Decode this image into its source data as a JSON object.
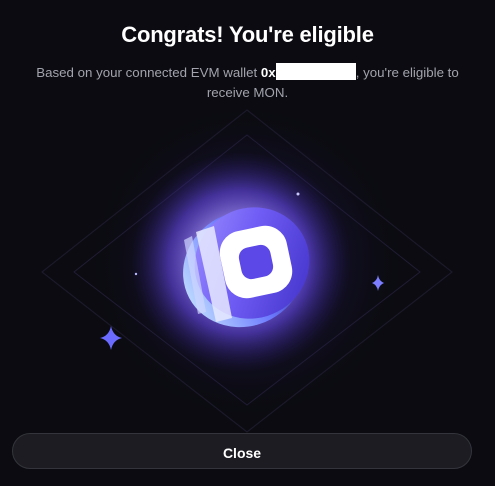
{
  "modal": {
    "title": "Congrats! You're eligible",
    "description_before": "Based on your connected EVM wallet ",
    "wallet_prefix": "0x",
    "description_after_line1": ", you're eligible to",
    "description_line2": "receive MON.",
    "close_label": "Close"
  },
  "colors": {
    "background": "#0b0b11",
    "accent": "#7b61ff",
    "button_bg": "#1c1c22"
  },
  "icons": [
    "monad-coin-icon",
    "sparkle-icon"
  ]
}
